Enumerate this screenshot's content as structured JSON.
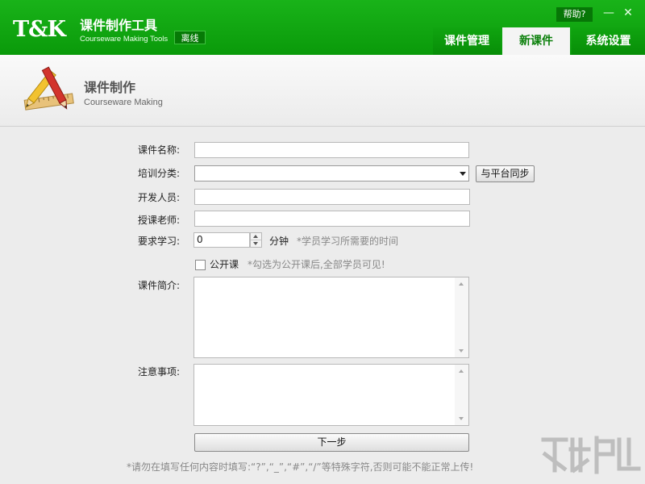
{
  "app": {
    "logo": "T&K",
    "name": "课件制作工具",
    "subtitle": "Courseware Making Tools",
    "status": "离线",
    "help_label": "帮助?",
    "minimize_glyph": "—",
    "close_glyph": "✕"
  },
  "tabs": [
    {
      "label": "课件管理",
      "active": false
    },
    {
      "label": "新课件",
      "active": true
    },
    {
      "label": "系统设置",
      "active": false
    }
  ],
  "section": {
    "title": "课件制作",
    "subtitle": "Courseware Making",
    "icon": "pencil-ruler-icon"
  },
  "form": {
    "name_label": "课件名称:",
    "name_value": "",
    "category_label": "培训分类:",
    "category_selected": "",
    "sync_button": "与平台同步",
    "developer_label": "开发人员:",
    "developer_value": "",
    "teacher_label": "授课老师:",
    "teacher_value": "",
    "study_label": "要求学习:",
    "study_value": "0",
    "study_unit": "分钟",
    "study_hint": "*学员学习所需要的时间",
    "public_label": "公开课",
    "public_checked": false,
    "public_hint": "*勾选为公开课后,全部学员可见!",
    "intro_label": "课件简介:",
    "intro_value": "",
    "notes_label": "注意事项:",
    "notes_value": "",
    "next_button": "下一步",
    "footer_note": "*请勿在填写任何内容时填写:“?”,“_”,“#”,“/”等特殊字符,否则可能不能正常上传!"
  },
  "colors": {
    "brand_green": "#0fa60f",
    "active_tab_text": "#0a7f0a"
  }
}
